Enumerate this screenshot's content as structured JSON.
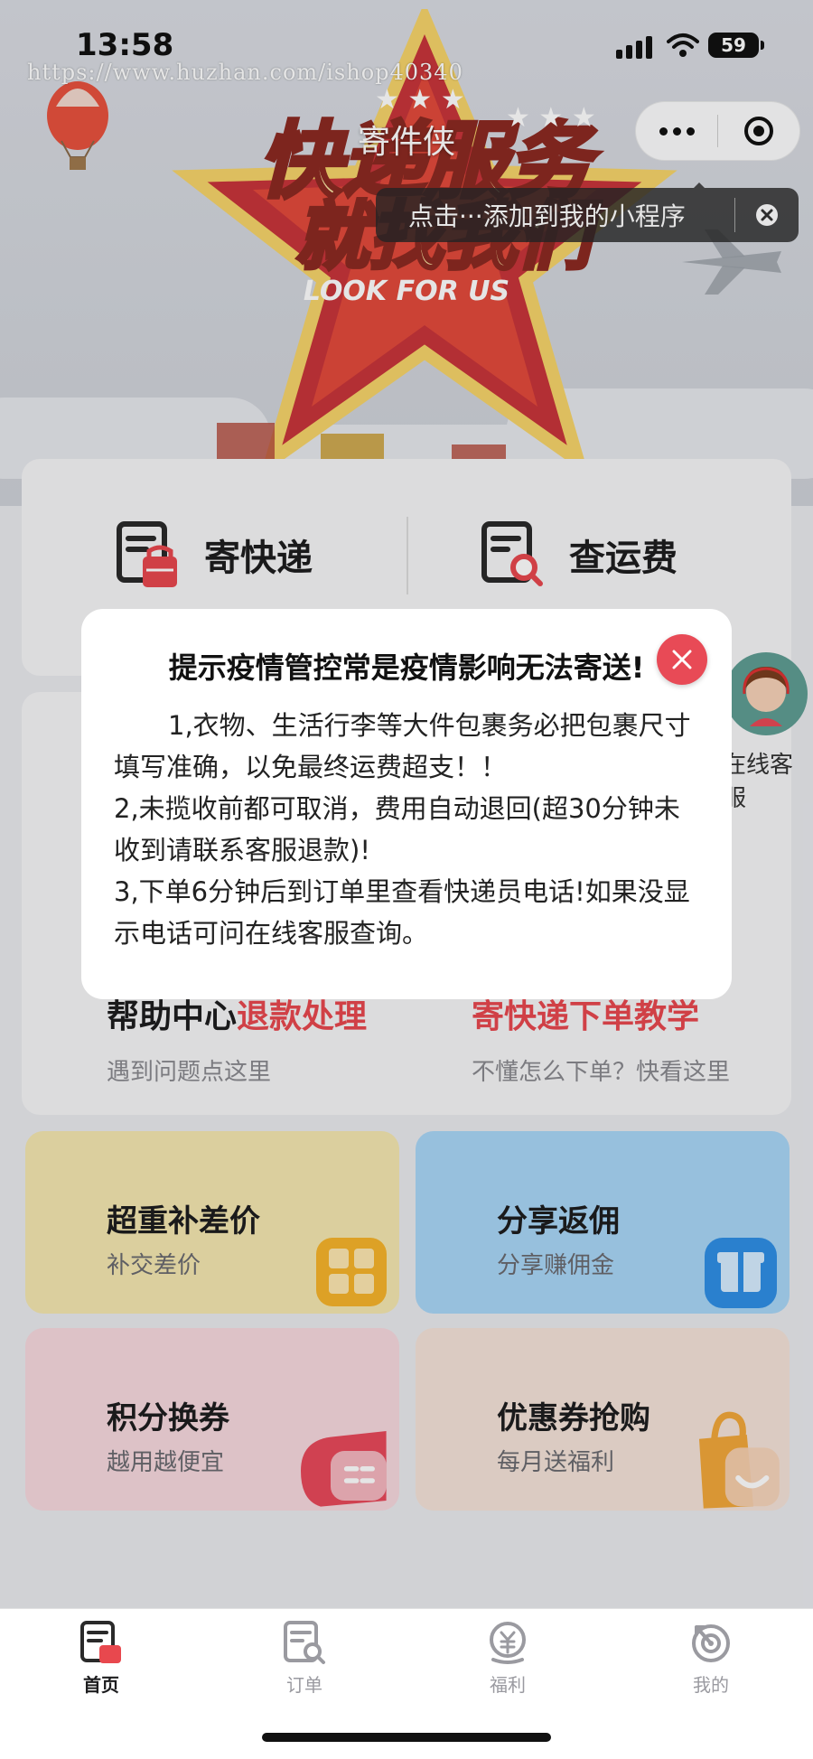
{
  "status_bar": {
    "time": "13:58",
    "battery": "59"
  },
  "watermark": "https://www.huzhan.com/ishop40340",
  "header": {
    "title": "寄件侠",
    "more_icon": "more-dots-icon",
    "close_icon": "target-close-icon",
    "tip_text": "点击···添加到我的小程序"
  },
  "banner": {
    "headline": "快递服务就找我们",
    "subline": "LOOK FOR US"
  },
  "actions": {
    "send_label": "寄快递",
    "fee_label": "查运费"
  },
  "customer_service": {
    "label": "在线客服"
  },
  "help": {
    "help_center": "帮助中心",
    "refund": "退款处理",
    "help_desc": "遇到问题点这里",
    "tutorial": "寄快递下单教学",
    "tutorial_desc": "不懂怎么下单？快看这里"
  },
  "tiles": [
    {
      "title": "超重补差价",
      "subtitle": "补交差价",
      "icon": "calculator-icon",
      "color": "#f4e7b0"
    },
    {
      "title": "分享返佣",
      "subtitle": "分享赚佣金",
      "icon": "gift-icon",
      "color": "#a9d6f7"
    },
    {
      "title": "积分换券",
      "subtitle": "越用越便宜",
      "icon": "ticket-icon",
      "color": "#f7d8de"
    },
    {
      "title": "优惠券抢购",
      "subtitle": "每月送福利",
      "icon": "shopping-bag-icon",
      "color": "#f4e3d8"
    }
  ],
  "modal": {
    "title": "提示疫情管控常是疫情影响无法寄送!",
    "lines": [
      "1,衣物、生活行李等大件包裹务必把包裹尺寸填写准确，以免最终运费超支！！",
      "2,未揽收前都可取消，费用自动退回(超30分钟未收到请联系客服退款)!",
      "3,下单6分钟后到订单里查看快递员电话!如果没显示电话可问在线客服查询。"
    ]
  },
  "tabbar": {
    "items": [
      {
        "label": "首页",
        "icon": "home-parcel-icon",
        "active": true
      },
      {
        "label": "订单",
        "icon": "order-search-icon",
        "active": false
      },
      {
        "label": "福利",
        "icon": "yuan-coin-icon",
        "active": false
      },
      {
        "label": "我的",
        "icon": "target-profile-icon",
        "active": false
      }
    ]
  },
  "colors": {
    "accent_red": "#e8484e",
    "modal_close": "#e84a56"
  }
}
